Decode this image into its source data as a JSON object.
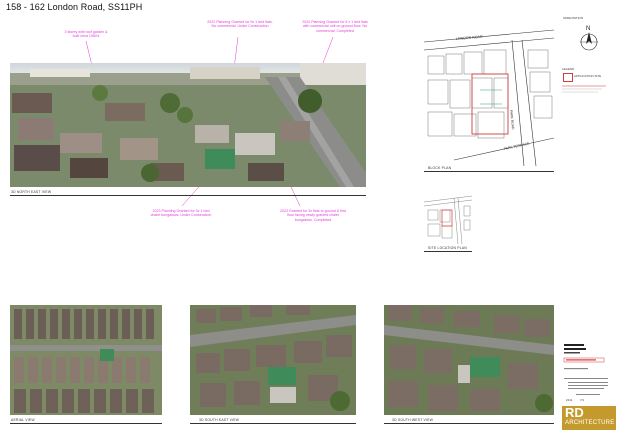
{
  "sheet": {
    "title": "158 - 162 London Road, SS11PH"
  },
  "annotations": [
    "3 storey with roof garden & built circa 1980's",
    "2022 Planning Granted for 9x 1 bed flats. No commercial. Under Construction",
    "2020 Planning Granted for 6 x 1 bed flats with commercial unit on ground floor. No commercial. Completed",
    "2023 Planning Granted for 3x 1 bed chalet bungalows. Under Construction",
    "2023 Granted for 3x flats to ground & first floor facing newly granted chalet bungalows. Completed"
  ],
  "views": {
    "north_east": "3D NORTH EAST VIEW",
    "aerial": "AERIAL VIEW",
    "south_east": "3D SOUTH EAST VIEW",
    "south_west": "3D SOUTH WEST VIEW"
  },
  "plans": {
    "block_plan": "BLOCK PLAN",
    "site_location": "SITE LOCATION PLAN",
    "road_london": "LONDON ROAD",
    "road_park": "PARK TERRACE",
    "road_park_road": "PARK ROAD",
    "orientation": "ORIENTATION",
    "north": "N",
    "legend": "LEGEND",
    "application_site": "APPLICATION SITE"
  },
  "title_block": {
    "logo_main": "RD",
    "logo_sub": "ARCHITECTURE",
    "drawing_no": "2311",
    "revision": "P1"
  },
  "colors": {
    "annotation": "#e23bd8",
    "site_outline": "#d23c3c",
    "logo_gold": "#c49a2c"
  }
}
